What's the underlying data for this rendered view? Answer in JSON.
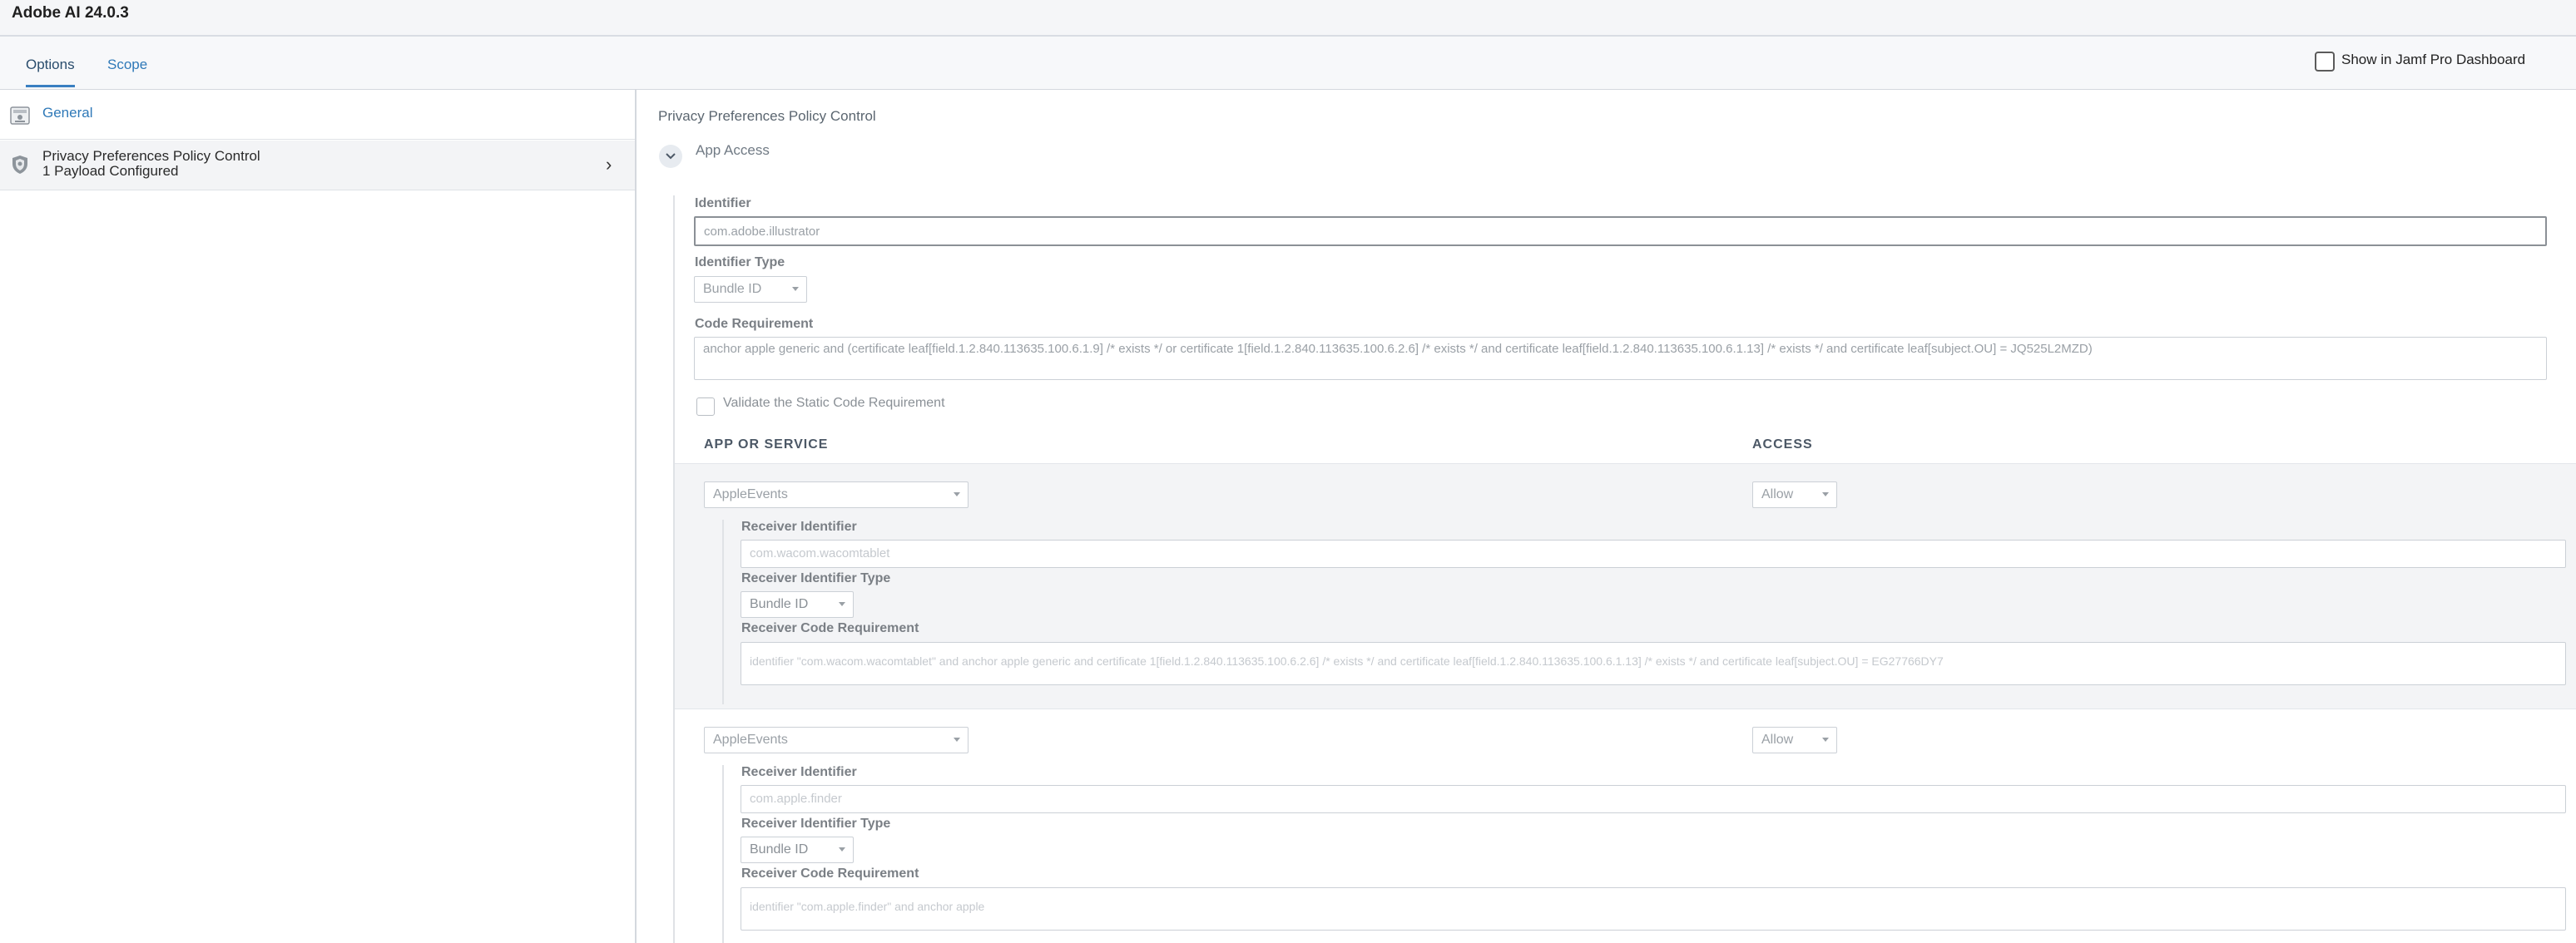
{
  "window": {
    "title": "Adobe AI 24.0.3"
  },
  "tabs": {
    "options": "Options",
    "scope": "Scope"
  },
  "dashboard": {
    "label": "Show in Jamf Pro Dashboard"
  },
  "sidebar": {
    "general": {
      "label": "General",
      "icon": "general-icon"
    },
    "ppc": {
      "label": "Privacy Preferences Policy Control",
      "sublabel": "1 Payload Configured",
      "icon": "shield-icon"
    }
  },
  "main": {
    "heading": "Privacy Preferences Policy Control",
    "section": "App Access",
    "identifier": {
      "label": "Identifier",
      "value": "com.adobe.illustrator"
    },
    "identifier_type": {
      "label": "Identifier Type",
      "value": "Bundle ID"
    },
    "code_requirement": {
      "label": "Code Requirement",
      "value": "anchor apple generic and (certificate leaf[field.1.2.840.113635.100.6.1.9] /* exists */ or certificate 1[field.1.2.840.113635.100.6.2.6] /* exists */ and certificate leaf[field.1.2.840.113635.100.6.1.13] /* exists */ and certificate leaf[subject.OU] = JQ525L2MZD)"
    },
    "validate": {
      "label": "Validate the Static Code Requirement"
    },
    "columns": {
      "app_or_service": "APP OR SERVICE",
      "access": "ACCESS"
    },
    "services": [
      {
        "service": "AppleEvents",
        "access": "Allow",
        "receiver_identifier_label": "Receiver Identifier",
        "receiver_identifier": "com.wacom.wacomtablet",
        "receiver_identifier_type_label": "Receiver Identifier Type",
        "receiver_identifier_type": "Bundle ID",
        "receiver_code_requirement_label": "Receiver Code Requirement",
        "receiver_code_requirement": "identifier \"com.wacom.wacomtablet\" and anchor apple generic and certificate 1[field.1.2.840.113635.100.6.2.6] /* exists */ and certificate leaf[field.1.2.840.113635.100.6.1.13] /* exists */ and certificate leaf[subject.OU] = EG27766DY7"
      },
      {
        "service": "AppleEvents",
        "access": "Allow",
        "receiver_identifier_label": "Receiver Identifier",
        "receiver_identifier": "com.apple.finder",
        "receiver_identifier_type_label": "Receiver Identifier Type",
        "receiver_identifier_type": "Bundle ID",
        "receiver_code_requirement_label": "Receiver Code Requirement",
        "receiver_code_requirement": "identifier \"com.apple.finder\" and anchor apple"
      }
    ]
  }
}
